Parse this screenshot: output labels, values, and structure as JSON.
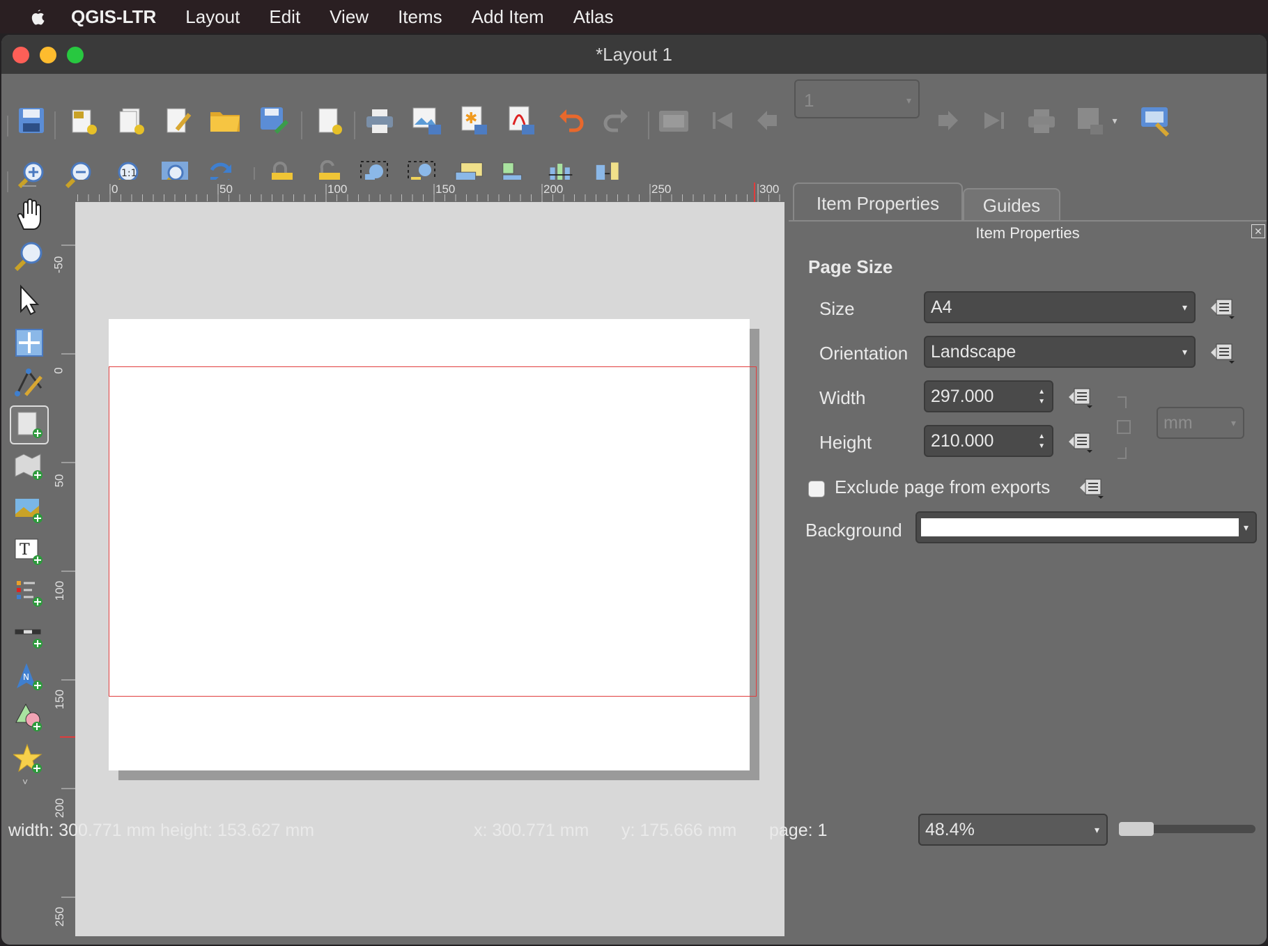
{
  "menubar": {
    "app": "QGIS-LTR",
    "items": [
      "Layout",
      "Edit",
      "View",
      "Items",
      "Add Item",
      "Atlas"
    ]
  },
  "window": {
    "title": "*Layout 1"
  },
  "toolbar": {
    "page_number": "1"
  },
  "rulers": {
    "horizontal": [
      "0",
      "50",
      "100",
      "150",
      "200",
      "250",
      "300"
    ],
    "vertical": [
      "-50",
      "0",
      "50",
      "100",
      "150",
      "200",
      "250"
    ]
  },
  "panel": {
    "tabs": [
      "Item Properties",
      "Guides"
    ],
    "header": "Item Properties",
    "section": "Page Size",
    "size_label": "Size",
    "size_value": "A4",
    "orientation_label": "Orientation",
    "orientation_value": "Landscape",
    "width_label": "Width",
    "width_value": "297.000",
    "height_label": "Height",
    "height_value": "210.000",
    "unit": "mm",
    "exclude_label": "Exclude page from exports",
    "exclude_checked": false,
    "background_label": "Background",
    "background_color": "#ffffff"
  },
  "status": {
    "dimensions": "width: 300.771 mm height: 153.627 mm",
    "x": "x: 300.771 mm",
    "y": "y: 175.666 mm",
    "page": "page: 1",
    "zoom": "48.4%"
  },
  "colors": {
    "selection": "#e03c3c",
    "accent_close": "#fe5f57",
    "accent_min": "#febc2e",
    "accent_max": "#28c840"
  }
}
